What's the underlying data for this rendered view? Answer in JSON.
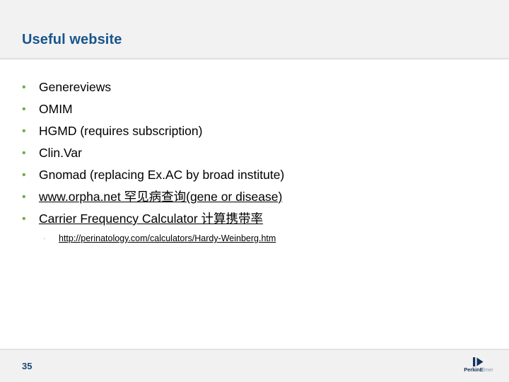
{
  "slide": {
    "title": "Useful website",
    "page_number": "35",
    "accent_title_color": "#18568d",
    "bullet_color": "#76a845",
    "header_bg": "#f2f2f2",
    "footer_bg": "#f1f1f1"
  },
  "bullets": [
    {
      "marker": "•",
      "text": "Genereviews",
      "link": false
    },
    {
      "marker": "•",
      "text": "OMIM",
      "link": false
    },
    {
      "marker": "•",
      "text": "HGMD (requires subscription)",
      "link": false
    },
    {
      "marker": "•",
      "text": "Clin.Var",
      "link": false
    },
    {
      "marker": "•",
      "text": "Gnomad (replacing Ex.AC by broad institute)",
      "link": false
    },
    {
      "marker": "•",
      "text": "www.orpha.net 罕见病查询(gene or disease)",
      "link": true
    },
    {
      "marker": "•",
      "text": "Carrier Frequency Calculator 计算携带率",
      "link": true
    }
  ],
  "sub_bullets": [
    {
      "marker": "◦",
      "text": "http://perinatology.com/calculators/Hardy-Weinberg.htm",
      "link": true
    }
  ],
  "logo": {
    "brand_primary": "PerkinE",
    "brand_secondary": "lmer",
    "icon": "perkinelmer-mark"
  }
}
